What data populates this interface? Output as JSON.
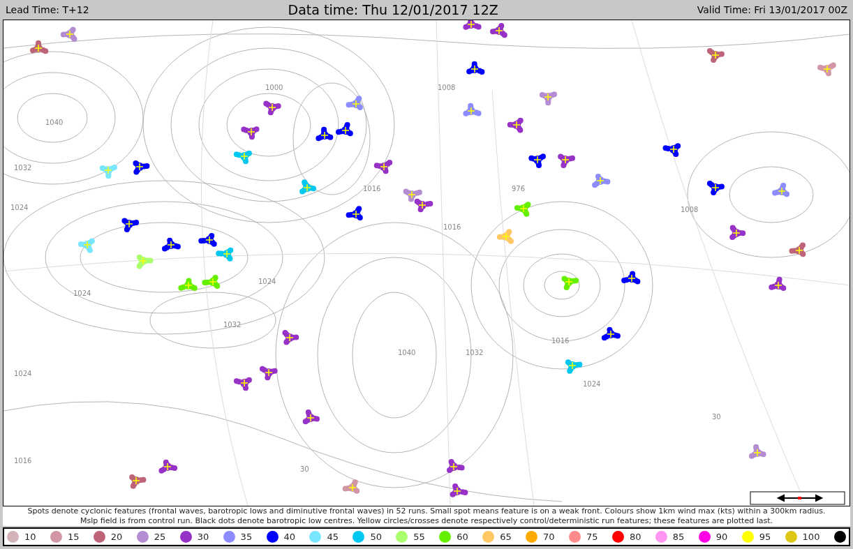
{
  "header": {
    "lead_time": "Lead Time: T+12",
    "data_time": "Data time:  Thu 12/01/2017 12Z",
    "valid_time": "Valid Time: Fri 13/01/2017 00Z"
  },
  "map": {
    "isobar_labels": [
      "1040",
      "1032",
      "1024",
      "1000",
      "1016",
      "1008",
      "1016",
      "1024",
      "1032",
      "1040",
      "1032",
      "1024",
      "1016",
      "1024",
      "976",
      "1008",
      "1016",
      "1024",
      "30",
      "30"
    ]
  },
  "notes": [
    "Spots denote cyclonic features (frontal waves, barotropic lows and diminutive frontal waves) in 52 runs. Small spot means feature is on a weak front. Colours show 1km wind max (kts) within a 300km radius.",
    "Mslp field is from control run. Black dots denote barotropic low centres. Yellow circles/crosses denote respectively control/deterministic run features; these features are plotted last."
  ],
  "legend": [
    {
      "label": "10",
      "color": "#d2b4b9"
    },
    {
      "label": "15",
      "color": "#d296a5"
    },
    {
      "label": "20",
      "color": "#be6478"
    },
    {
      "label": "25",
      "color": "#b48cd2"
    },
    {
      "label": "30",
      "color": "#9632c8"
    },
    {
      "label": "35",
      "color": "#8c8cff"
    },
    {
      "label": "40",
      "color": "#0000ff"
    },
    {
      "label": "45",
      "color": "#78e6ff"
    },
    {
      "label": "50",
      "color": "#00c8f0"
    },
    {
      "label": "55",
      "color": "#aaff6e"
    },
    {
      "label": "60",
      "color": "#64f000"
    },
    {
      "label": "65",
      "color": "#ffc864"
    },
    {
      "label": "70",
      "color": "#ffaa00"
    },
    {
      "label": "75",
      "color": "#ff8c8c"
    },
    {
      "label": "80",
      "color": "#ff0000"
    },
    {
      "label": "85",
      "color": "#ff96f0"
    },
    {
      "label": "90",
      "color": "#ff00e6"
    },
    {
      "label": "95",
      "color": "#ffff00"
    },
    {
      "label": "100",
      "color": "#dcc814"
    },
    {
      "color": "#000000"
    }
  ]
}
